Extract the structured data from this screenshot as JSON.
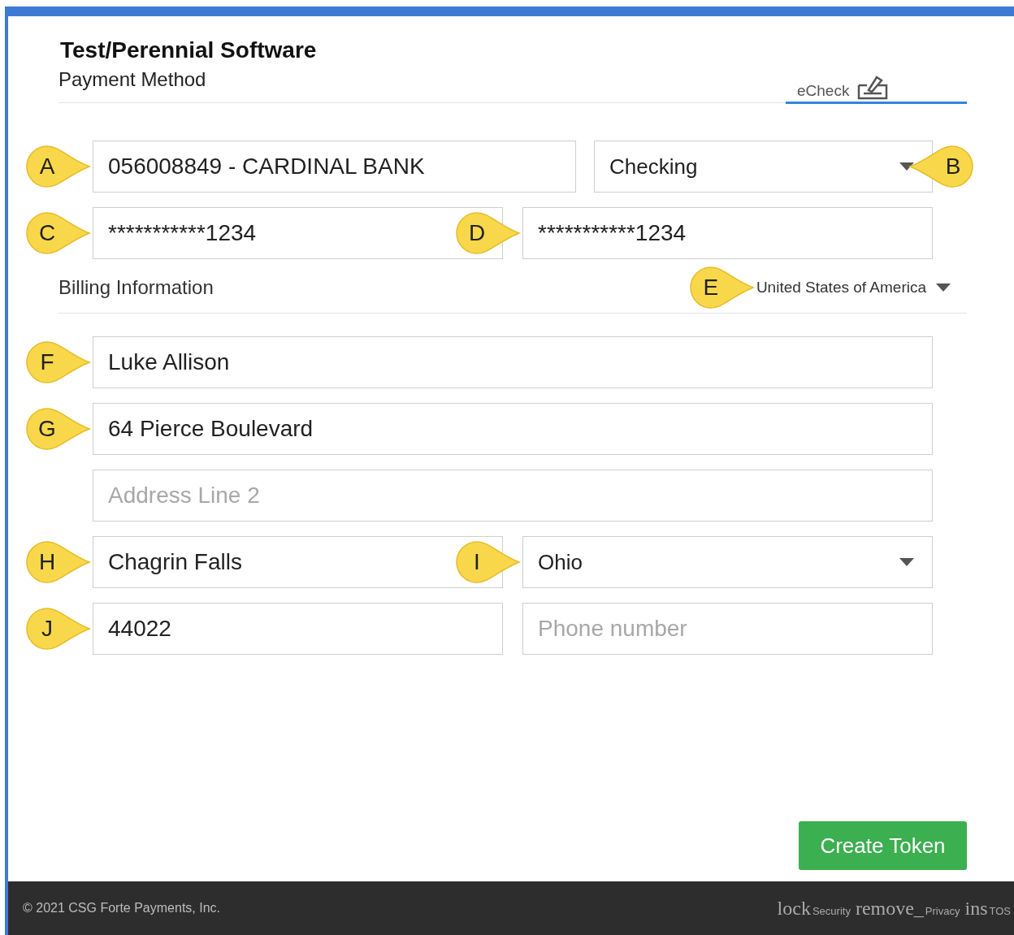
{
  "header": {
    "title": "Test/Perennial Software",
    "subtitle": "Payment Method"
  },
  "tabs": [
    {
      "label": "eCheck",
      "selected": true
    }
  ],
  "account_rows": [
    [
      {
        "kind": "input",
        "value": "056008849 - CARDINAL BANK",
        "callout": "A"
      },
      {
        "kind": "select",
        "value": "Checking",
        "callout": "B"
      }
    ],
    [
      {
        "kind": "input",
        "value": "***********1234",
        "callout": "C"
      },
      {
        "kind": "input",
        "value": "***********1234",
        "callout": "D"
      }
    ]
  ],
  "billing": {
    "title": "Billing Information",
    "country": {
      "value": "United States of America",
      "callout": "E"
    }
  },
  "billing_rows": [
    [
      {
        "kind": "input",
        "value": "Luke Allison",
        "callout": "F"
      }
    ],
    [
      {
        "kind": "input",
        "value": "64 Pierce Boulevard",
        "callout": "G"
      }
    ],
    [
      {
        "kind": "input",
        "placeholder": "Address Line 2"
      }
    ],
    [
      {
        "kind": "input",
        "value": "Chagrin Falls",
        "callout": "H"
      },
      {
        "kind": "select",
        "value": "Ohio",
        "callout": "I"
      }
    ],
    [
      {
        "kind": "input",
        "value": "44022",
        "callout": "J"
      },
      {
        "kind": "input",
        "placeholder": "Phone number"
      }
    ]
  ],
  "button": "Create Token",
  "footer": {
    "copyright": "© 2021 CSG Forte Payments, Inc.",
    "links": [
      {
        "icon": "lock",
        "label": "Security"
      },
      {
        "icon": "remove_",
        "label": "Privacy"
      },
      {
        "icon": "ins",
        "label": "TOS"
      }
    ]
  }
}
